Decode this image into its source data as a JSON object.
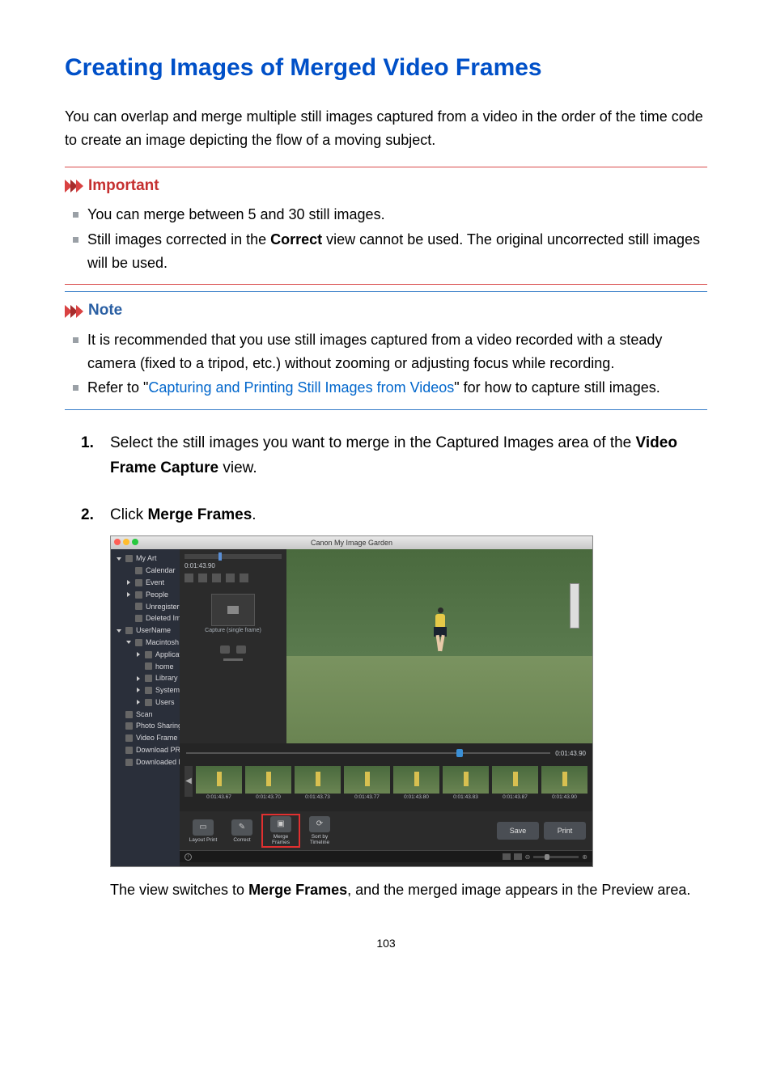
{
  "title": "Creating Images of Merged Video Frames",
  "intro": "You can overlap and merge multiple still images captured from a video in the order of the time code to create an image depicting the flow of a moving subject.",
  "important": {
    "heading": "Important",
    "items": [
      {
        "text": "You can merge between 5 and 30 still images."
      },
      {
        "pre": "Still images corrected in the ",
        "bold": "Correct",
        "post": " view cannot be used. The original uncorrected still images will be used."
      }
    ]
  },
  "note": {
    "heading": "Note",
    "items": [
      {
        "text": "It is recommended that you use still images captured from a video recorded with a steady camera (fixed to a tripod, etc.) without zooming or adjusting focus while recording."
      },
      {
        "pre": "Refer to \"",
        "link": "Capturing and Printing Still Images from Videos",
        "post": "\" for how to capture still images."
      }
    ]
  },
  "steps": {
    "s1": {
      "pre": "Select the still images you want to merge in the Captured Images area of the ",
      "bold": "Video Frame Capture",
      "post": " view."
    },
    "s2": {
      "pre": "Click ",
      "bold": "Merge Frames",
      "post": "."
    },
    "s2_after": {
      "pre": "The view switches to ",
      "bold": "Merge Frames",
      "post": ", and the merged image appears in the Preview area."
    }
  },
  "app": {
    "title": "Canon My Image Garden",
    "sidebar": [
      {
        "label": "My Art",
        "level": 1,
        "caret": "open"
      },
      {
        "label": "Calendar",
        "level": 2
      },
      {
        "label": "Event",
        "level": 2,
        "caret": "closed"
      },
      {
        "label": "People",
        "level": 2,
        "caret": "closed"
      },
      {
        "label": "Unregistered People",
        "level": 2
      },
      {
        "label": "Deleted Images of People",
        "level": 2
      },
      {
        "label": "UserName",
        "level": 1,
        "caret": "open"
      },
      {
        "label": "Macintosh HD",
        "level": 2,
        "caret": "open"
      },
      {
        "label": "Applications",
        "level": 3,
        "caret": "closed"
      },
      {
        "label": "home",
        "level": 3
      },
      {
        "label": "Library",
        "level": 3,
        "caret": "closed"
      },
      {
        "label": "System",
        "level": 3,
        "caret": "closed"
      },
      {
        "label": "Users",
        "level": 3,
        "caret": "closed"
      },
      {
        "label": "Scan",
        "level": 1
      },
      {
        "label": "Photo Sharing Sites",
        "level": 1
      },
      {
        "label": "Video Frame Capture",
        "level": 1
      },
      {
        "label": "Download PREMIUM Contents",
        "level": 1
      },
      {
        "label": "Downloaded PREMIUM Contents",
        "level": 1
      }
    ],
    "timecode_small": "0:01:43.90",
    "capture_label": "Capture (single frame)",
    "timeline_time": "0:01:43.90",
    "thumbs": [
      "0:01:43.67",
      "0:01:43.70",
      "0:01:43.73",
      "0:01:43.77",
      "0:01:43.80",
      "0:01:43.83",
      "0:01:43.87",
      "0:01:43.90"
    ],
    "toolbar": {
      "layout": "Layout Print",
      "correct": "Correct",
      "merge": "Merge Frames",
      "sort": "Sort by Timeline",
      "save": "Save",
      "print": "Print"
    }
  },
  "page_number": "103"
}
